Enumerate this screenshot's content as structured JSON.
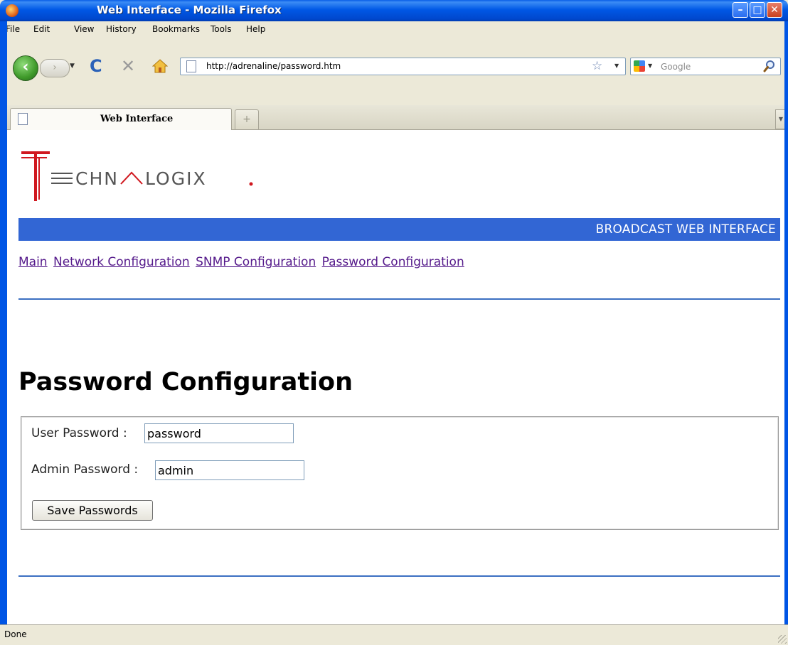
{
  "window": {
    "title": "Web Interface - Mozilla Firefox"
  },
  "menu": {
    "items": [
      "File",
      "Edit",
      "View",
      "History",
      "Bookmarks",
      "Tools",
      "Help"
    ]
  },
  "toolbar": {
    "url": "http://adrenaline/password.htm",
    "search_placeholder": "Google"
  },
  "tabs": {
    "active_label": "Web Interface",
    "new_tab_glyph": "+"
  },
  "page": {
    "logo_text": "TECHNALOGIX.",
    "banner": "BROADCAST WEB INTERFACE",
    "nav_links": [
      "Main",
      "Network Configuration",
      "SNMP Configuration",
      "Password Configuration"
    ],
    "title": "Password Configuration",
    "form": {
      "user_label": "User Password :",
      "user_value": "password",
      "admin_label": "Admin Password :",
      "admin_value": "admin",
      "save_label": "Save Passwords"
    }
  },
  "status": {
    "text": "Done"
  },
  "colors": {
    "banner": "#3266d4",
    "logo_red": "#d0181f",
    "link_visited": "#551a8b",
    "rule": "#3b6fc2"
  }
}
